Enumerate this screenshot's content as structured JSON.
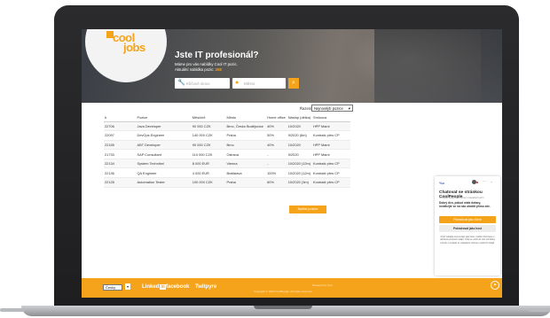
{
  "hero": {
    "logo_top": "cool",
    "logo_bottom": "jobs",
    "title": "Jste IT profesionál?",
    "subtitle": "Máme pro vás nabídky Cool IT pozic.",
    "count_text": "Aktuální nabídka pozic:",
    "count": "258",
    "keyword_placeholder": "Klíčové slovo",
    "location_placeholder": "Město",
    "search_icon": "search-icon"
  },
  "sort": {
    "label": "Řazení",
    "value": "Nejnovější pozice"
  },
  "table": {
    "headers": [
      "#",
      "Pozice",
      "Měsíčně",
      "Město",
      "Home office",
      "Nástup (délka)",
      "Smlouva"
    ],
    "rows": [
      [
        "22706",
        "Java Developer",
        "90 000 CZK",
        "Brno, Česko Budějovice",
        "40%",
        "10/2020",
        "HPP Mami"
      ],
      [
        "22097",
        "DevOps Engineer",
        "140 000 CZK",
        "Praha",
        "50%",
        "9/2020 (6m)",
        "Kontrakt přes CP"
      ],
      [
        "22155",
        "ABT Developer",
        "90 000 CZK",
        "Brno",
        "40%",
        "10/2020",
        "HPP Mami"
      ],
      [
        "21733",
        "SAP Consultant",
        "110 000 CZK",
        "Ostrava",
        "-",
        "9/2020",
        "HPP Mami"
      ],
      [
        "22134",
        "System Technikel",
        "8 000 EUR",
        "Vienna",
        "-",
        "10/2020 (12m)",
        "Kontrakt přes CP"
      ],
      [
        "22136",
        "QA Engineer",
        "4 000 EUR",
        "Bratislava",
        "100%",
        "10/2020 (12m)",
        "Kontrakt přes CP"
      ],
      [
        "22128",
        "Automation Tester",
        "100 000 CZK",
        "Praha",
        "60%",
        "10/2020 (3m)",
        "Kontrakt přes CP"
      ]
    ]
  },
  "more_button": "Načíst pozice",
  "footer": {
    "language": "Česky",
    "linkedin": "Linked",
    "linkedin_in": "in",
    "facebook": "facebook",
    "twitter": "Twitpyre",
    "powered": "Powered by Vipa",
    "copyright": "Copyright © 2020 CoolPeople. All rights reserved."
  },
  "chat": {
    "brand": "%o",
    "title": "Chatovat se stránkou CoolPeople",
    "subtitle": "Obvykle odpovídá během několika hodin",
    "text1": "Dobrý den, pokud máte dotazy,",
    "text2": "neváhejte se na nás obrátit přímo zde.",
    "primary_button": "Pokračovat jako Mirek",
    "secondary_button": "Pokračovat jako host",
    "fine_print": "Když zahájíte konverzaci jako host, uvidíte informace o ochraně osobních údajů. Chat se uloží do vaší schránky a bude v souladu se zásadami ochrany osobních údajů."
  },
  "colors": {
    "accent": "#f5a31a",
    "hero_dark": "#3a3e45"
  }
}
